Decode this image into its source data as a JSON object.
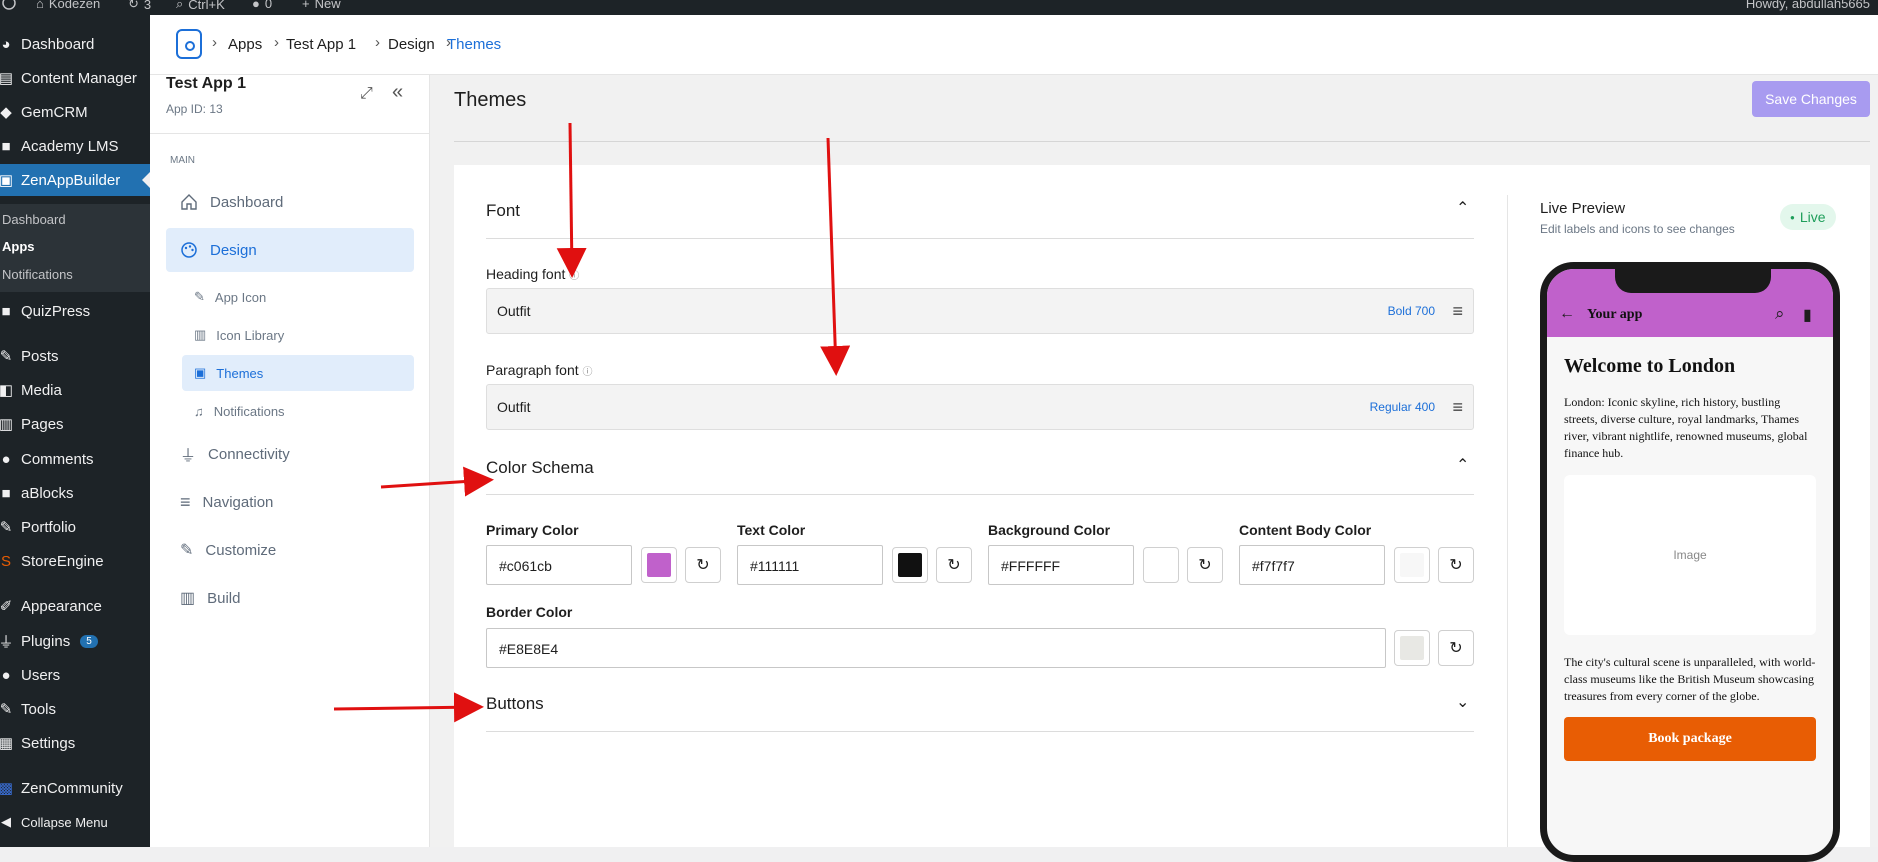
{
  "adminbar": {
    "site_name": "Kodezen",
    "updates_count": "3",
    "search_shortcut": "Ctrl+K",
    "comments_count": "0",
    "new_label": "New",
    "howdy": "Howdy, abdullah5665"
  },
  "wp_menu": {
    "items": [
      {
        "label": "Dashboard",
        "icon": "gauge-icon"
      },
      {
        "label": "Content Manager",
        "icon": "content-icon"
      },
      {
        "label": "GemCRM",
        "icon": "gem-icon"
      },
      {
        "label": "Academy LMS",
        "icon": "academy-icon"
      },
      {
        "label": "ZenAppBuilder",
        "icon": "app-icon"
      },
      {
        "label": "QuizPress",
        "icon": "quiz-icon"
      },
      {
        "label": "Posts",
        "icon": "pin-icon"
      },
      {
        "label": "Media",
        "icon": "media-icon"
      },
      {
        "label": "Pages",
        "icon": "pages-icon"
      },
      {
        "label": "Comments",
        "icon": "comment-icon"
      },
      {
        "label": "aBlocks",
        "icon": "blocks-icon"
      },
      {
        "label": "Portfolio",
        "icon": "pin-icon"
      },
      {
        "label": "StoreEngine",
        "icon": "store-icon"
      },
      {
        "label": "Appearance",
        "icon": "brush-icon"
      },
      {
        "label": "Plugins",
        "icon": "plug-icon",
        "badge": "5"
      },
      {
        "label": "Users",
        "icon": "user-icon"
      },
      {
        "label": "Tools",
        "icon": "wrench-icon"
      },
      {
        "label": "Settings",
        "icon": "sliders-icon"
      },
      {
        "label": "ZenCommunity",
        "icon": "community-icon"
      },
      {
        "label": "Collapse Menu",
        "icon": "collapse-icon"
      }
    ],
    "submenu": [
      "Dashboard",
      "Apps",
      "Notifications"
    ]
  },
  "breadcrumb": [
    "Apps",
    "Test App 1",
    "Design",
    "Themes"
  ],
  "app": {
    "title": "Test App 1",
    "id_label": "App ID: 13",
    "section_label": "MAIN"
  },
  "app_nav": {
    "items": [
      "Dashboard",
      "Design",
      "Connectivity",
      "Navigation",
      "Customize",
      "Build"
    ],
    "design_sub": [
      "App Icon",
      "Icon Library",
      "Themes",
      "Notifications"
    ]
  },
  "page": {
    "title": "Themes",
    "save_label": "Save Changes"
  },
  "font": {
    "section_title": "Font",
    "heading_label": "Heading font",
    "heading_value": "Outfit",
    "heading_weight": "Bold 700",
    "paragraph_label": "Paragraph font",
    "paragraph_value": "Outfit",
    "paragraph_weight": "Regular 400"
  },
  "colors": {
    "section_title": "Color Schema",
    "items": [
      {
        "label": "Primary Color",
        "value": "#c061cb",
        "swatch": "#c061cb"
      },
      {
        "label": "Text Color",
        "value": "#111111",
        "swatch": "#111111"
      },
      {
        "label": "Background Color",
        "value": "#FFFFFF",
        "swatch": "#FFFFFF"
      },
      {
        "label": "Content Body Color",
        "value": "#f7f7f7",
        "swatch": "#f7f7f7"
      },
      {
        "label": "Border Color",
        "value": "#E8E8E4",
        "swatch": "#E8E8E4"
      }
    ]
  },
  "buttons": {
    "section_title": "Buttons"
  },
  "preview": {
    "title": "Live Preview",
    "subtitle": "Edit labels and icons to see changes",
    "live_label": "Live",
    "app_bar_title": "Your app",
    "heading": "Welcome to London",
    "para1": "London: Iconic skyline, rich history, bustling streets, diverse culture, royal landmarks, Thames river, vibrant nightlife, renowned museums, global finance hub.",
    "image_label": "Image",
    "para2": "The city's cultural scene is unparalleled, with world-class museums like the British Museum showcasing treasures from every corner of the globe.",
    "cta_label": "Book package",
    "cta_color": "#e85d04",
    "accent_color": "#1c6fd8"
  }
}
